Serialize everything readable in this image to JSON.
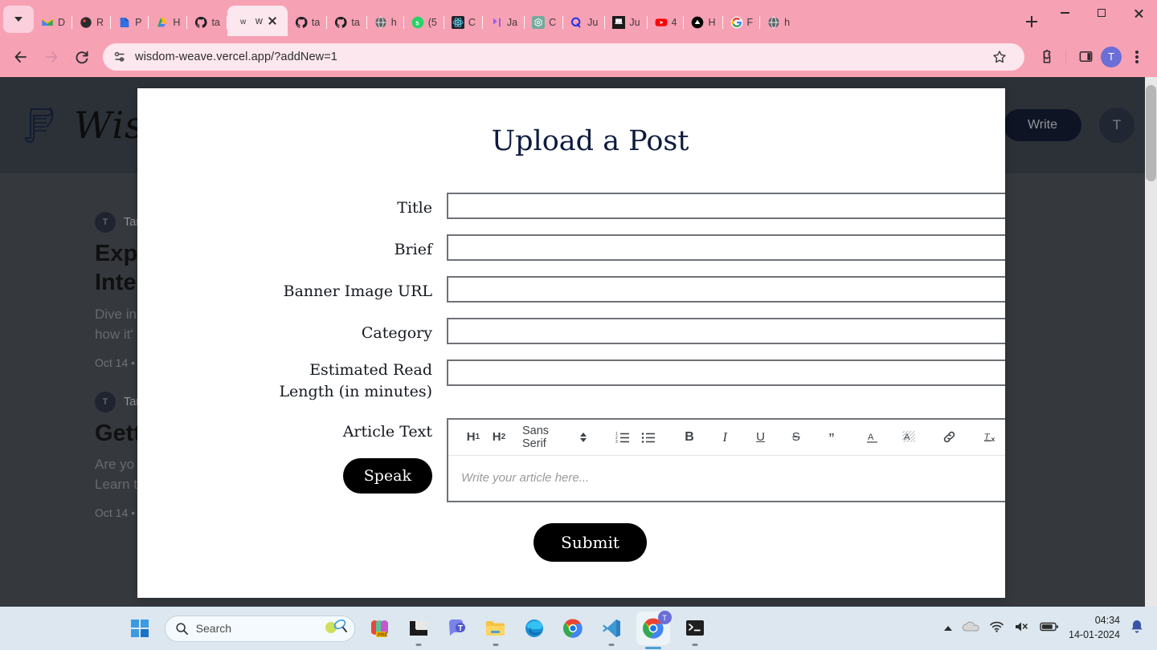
{
  "browser": {
    "tabs": [
      {
        "title": "D",
        "icon": "gmail-icon",
        "active": false
      },
      {
        "title": "R",
        "icon": "redux-icon",
        "active": false
      },
      {
        "title": "P",
        "icon": "google-docs-icon",
        "active": false
      },
      {
        "title": "H",
        "icon": "google-drive-icon",
        "active": false
      },
      {
        "title": "ta",
        "icon": "github-icon",
        "active": false
      },
      {
        "title": "w",
        "icon": "wisdom-weave-icon",
        "active": true
      },
      {
        "title": "ta",
        "icon": "github-icon",
        "active": false
      },
      {
        "title": "ta",
        "icon": "github-icon",
        "active": false
      },
      {
        "title": "h",
        "icon": "globe-icon",
        "active": false
      },
      {
        "title": "(5",
        "icon": "whatsapp-icon",
        "active": false
      },
      {
        "title": "C",
        "icon": "react-icon",
        "active": false
      },
      {
        "title": "Ja",
        "icon": "perplexity-icon",
        "active": false
      },
      {
        "title": "C",
        "icon": "chatgpt-icon",
        "active": false
      },
      {
        "title": "Ju",
        "icon": "quora-icon",
        "active": false
      },
      {
        "title": "Ju",
        "icon": "jupyter-icon",
        "active": false
      },
      {
        "title": "4",
        "icon": "youtube-icon",
        "active": false
      },
      {
        "title": "H",
        "icon": "vercel-icon",
        "active": false
      },
      {
        "title": "F",
        "icon": "google-icon",
        "active": false
      },
      {
        "title": "h",
        "icon": "globe-icon",
        "active": false
      }
    ],
    "url": "wisdom-weave.vercel.app/?addNew=1",
    "profile_initial": "T",
    "accent_pink": "#f7a1b5",
    "tab_active_bg": "#fde7ee"
  },
  "site": {
    "brand": "Wisdom",
    "write_button": "Write",
    "avatar_initial": "T",
    "posts": [
      {
        "avatar": "T",
        "author": "Tan",
        "title_line1": "Expl",
        "title_line2": "Intel",
        "excerpt_line1": "Dive in",
        "excerpt_line2": "how it'",
        "date": "Oct 14 •"
      },
      {
        "avatar": "T",
        "author": "Tan",
        "title_line1": "Gett",
        "title_line2": "",
        "excerpt_line1": "Are yo",
        "excerpt_line2": "Learn t",
        "date": "Oct 14 •"
      }
    ]
  },
  "modal": {
    "title": "Upload a Post",
    "fields": [
      {
        "label": "Title",
        "value": "",
        "placeholder": ""
      },
      {
        "label": "Brief",
        "value": "",
        "placeholder": ""
      },
      {
        "label": "Banner Image URL",
        "value": "",
        "placeholder": ""
      },
      {
        "label": "Category",
        "value": "",
        "placeholder": ""
      },
      {
        "label": "Estimated Read",
        "label2": "Length (in minutes)",
        "value": "",
        "placeholder": ""
      }
    ],
    "article_label": "Article Text",
    "speak_button": "Speak",
    "editor": {
      "h1": "H",
      "h1_sub": "1",
      "h2": "H",
      "h2_sub": "2",
      "font_family_selected": "Sans Serif",
      "placeholder": "Write your article here...",
      "tools": [
        "heading-1-icon",
        "heading-2-icon",
        "font-family-select",
        "ordered-list-icon",
        "bullet-list-icon",
        "bold-icon",
        "italic-icon",
        "underline-icon",
        "strikethrough-icon",
        "blockquote-icon",
        "text-color-icon",
        "highlight-color-icon",
        "link-icon",
        "clear-format-icon"
      ]
    },
    "submit_button": "Submit"
  },
  "taskbar": {
    "search_placeholder": "Search",
    "time": "04:34",
    "date": "14-01-2024",
    "apps": [
      "start-icon",
      "search-box",
      "office-icon",
      "file-manager-icon",
      "teams-icon",
      "file-explorer-icon",
      "edge-icon",
      "chrome-icon",
      "vscode-icon",
      "chrome-active-icon",
      "terminal-icon"
    ],
    "tray": [
      "show-hidden-icons",
      "onedrive-icon",
      "wifi-icon",
      "volume-muted-icon",
      "battery-icon",
      "notifications-icon"
    ]
  }
}
